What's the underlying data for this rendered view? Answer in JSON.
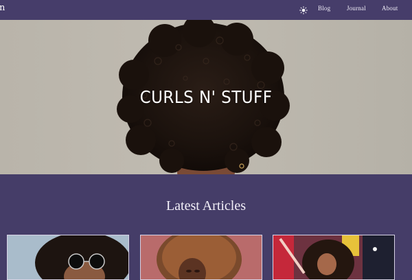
{
  "navbar": {
    "brand": "n",
    "theme_icon": "sun-icon",
    "links": [
      {
        "label": "Blog"
      },
      {
        "label": "Journal"
      },
      {
        "label": "About"
      }
    ]
  },
  "hero": {
    "title": "CURLS N' STUFF",
    "image": "curly-hair-hero-photo"
  },
  "articles": {
    "heading": "Latest Articles",
    "cards": [
      {
        "image": "curly-hair-sunglasses-photo"
      },
      {
        "image": "curly-hair-portrait-photo"
      },
      {
        "image": "curly-hair-city-photo"
      }
    ]
  },
  "colors": {
    "nav_bg": "#463d6a",
    "page_bg": "#453d68",
    "hero_bg": "#bdb8ae",
    "text_light": "#ffffff"
  }
}
